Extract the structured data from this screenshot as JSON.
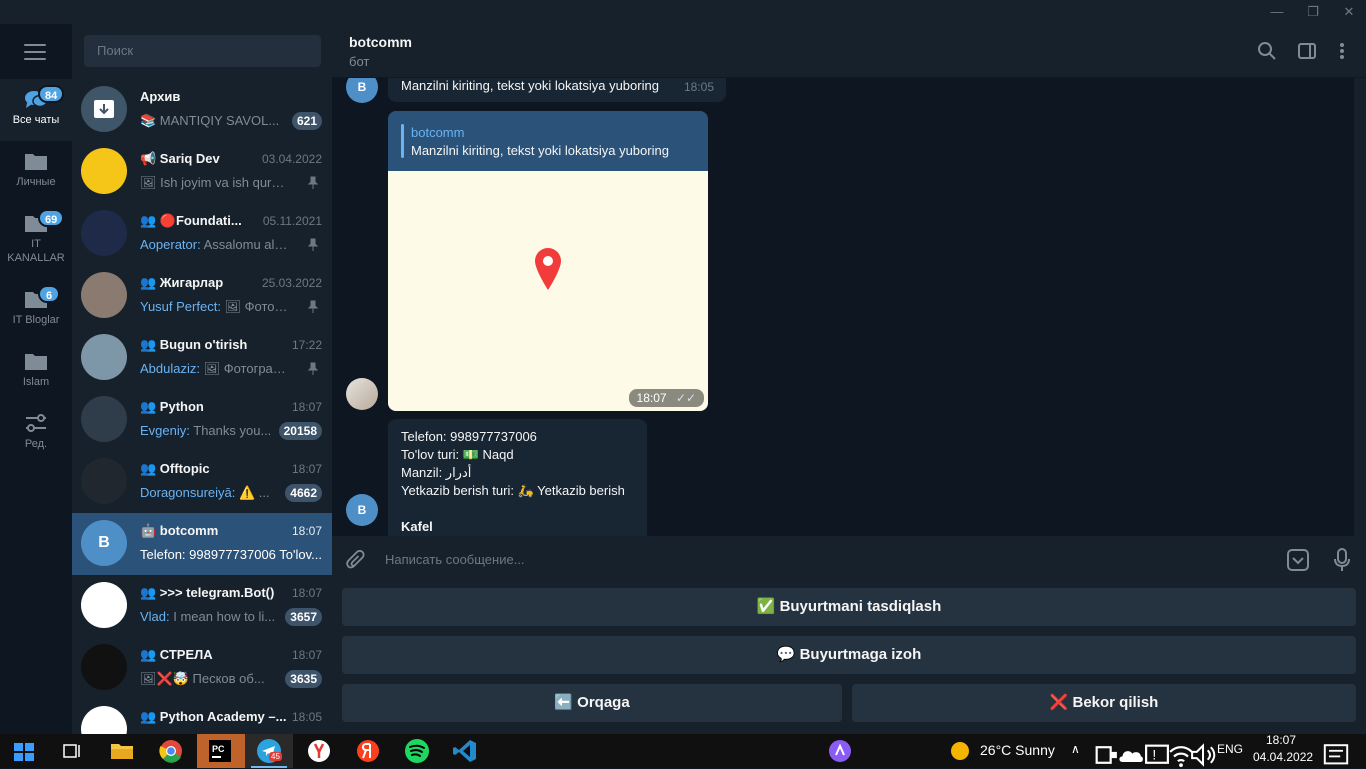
{
  "window": {
    "minimize": "—",
    "maximize": "❐",
    "close": "✕"
  },
  "folders": [
    {
      "label": "Все чаты",
      "badge": "84"
    },
    {
      "label": "Личные",
      "badge": ""
    },
    {
      "label": "IT KANALLAR",
      "badge": "69"
    },
    {
      "label": "IT Bloglar",
      "badge": "6"
    },
    {
      "label": "Islam",
      "badge": ""
    },
    {
      "label": "Ред.",
      "badge": ""
    }
  ],
  "search": {
    "placeholder": "Поиск"
  },
  "chats": [
    {
      "name": "Архив",
      "time": "",
      "author": "",
      "preview": "📚 MANTIQIY SAVOL...",
      "badge": "621",
      "avatar_color": "#3f5568",
      "avatar_letter": ""
    },
    {
      "name": "📢 Sariq Dev",
      "time": "03.04.2022",
      "author": "",
      "preview": "🖼 Ish joyim va ish qurol...",
      "badge": "",
      "avatar_color": "#f5c518",
      "avatar_letter": ""
    },
    {
      "name": "👥 🔴Foundati...",
      "time": "05.11.2021",
      "author": "Aoperator: ",
      "preview": "Assalomu ala...",
      "badge": "",
      "avatar_color": "#1e2a48",
      "avatar_letter": ""
    },
    {
      "name": "👥 Жигарлар",
      "time": "25.03.2022",
      "author": "Yusuf Perfect: ",
      "preview": "🖼 Фотогр...",
      "badge": "",
      "avatar_color": "#8a7a70",
      "avatar_letter": ""
    },
    {
      "name": "👥 Bugun o'tirish",
      "time": "17:22",
      "author": "Abdulaziz: ",
      "preview": "🖼 Фотограф...",
      "badge": "",
      "avatar_color": "#7d96a8",
      "avatar_letter": ""
    },
    {
      "name": "👥 Python",
      "time": "18:07",
      "author": "Evgeniy: ",
      "preview": "Thanks you...",
      "badge": "20158",
      "avatar_color": "#2f3c4a",
      "avatar_letter": ""
    },
    {
      "name": "👥 Offtopic",
      "time": "18:07",
      "author": "Doragonsureiyā: ",
      "preview": "⚠️ ...",
      "badge": "4662",
      "avatar_color": "#20272f",
      "avatar_letter": ""
    },
    {
      "name": "🤖 botcomm",
      "time": "18:07",
      "author": "",
      "preview": "Telefon: 998977737006 To'lov...",
      "badge": "",
      "avatar_color": "#4f8fc7",
      "avatar_letter": "B"
    },
    {
      "name": "👥 >>> telegram.Bot()",
      "time": "18:07",
      "author": "Vlad: ",
      "preview": "I mean how to li...",
      "badge": "3657",
      "avatar_color": "#ffffff",
      "avatar_letter": ""
    },
    {
      "name": "👥 СТРЕЛА",
      "time": "18:07",
      "author": "",
      "preview": "🖼❌🤯 Песков об...",
      "badge": "3635",
      "avatar_color": "#111111",
      "avatar_letter": ""
    },
    {
      "name": "👥 Python Academy –...",
      "time": "18:05",
      "author": "",
      "preview": "",
      "badge": "",
      "avatar_color": "#ffffff",
      "avatar_letter": ""
    }
  ],
  "header": {
    "title": "botcomm",
    "subtitle": "бот"
  },
  "messages": {
    "first": {
      "text": "Manzilni kiriting, tekst yoki lokatsiya yuboring",
      "time": "18:05",
      "avatar": "B"
    },
    "location": {
      "reply_name": "botcomm",
      "reply_text": "Manzilni kiriting, tekst yoki lokatsiya yuboring",
      "time": "18:07"
    },
    "order": {
      "lines": [
        "Telefon: 998977737006",
        "To'lov turi: 💵 Naqd",
        "Manzil: أدرار",
        "Yetkazib berish turi: 🛵 Yetkazib berish"
      ],
      "bold_line": "Kafel",
      "avatar": "B"
    }
  },
  "composer": {
    "placeholder": "Написать сообщение..."
  },
  "keyboard": {
    "confirm": "✅ Buyurtmani tasdiqlash",
    "comment": "💬 Buyurtmaga izoh",
    "back": "⬅️ Orqaga",
    "cancel": "❌ Bekor qilish"
  },
  "taskbar": {
    "telegram_badge": "45",
    "weather": "26°C  Sunny",
    "lang": "ENG",
    "time": "18:07",
    "date": "04.04.2022"
  }
}
